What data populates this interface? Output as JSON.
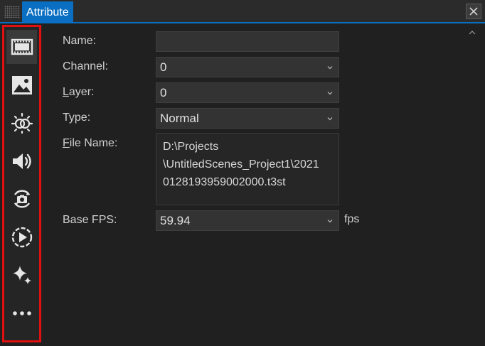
{
  "window": {
    "tab_title": "Attribute",
    "close_icon": "close-icon"
  },
  "sidebar": {
    "items": [
      {
        "icon": "film-icon",
        "selected": true
      },
      {
        "icon": "image-icon",
        "selected": false
      },
      {
        "icon": "brightness-icon",
        "selected": false
      },
      {
        "icon": "speaker-icon",
        "selected": false
      },
      {
        "icon": "camera-rotate-icon",
        "selected": false
      },
      {
        "icon": "play-circle-icon",
        "selected": false
      },
      {
        "icon": "sparkle-icon",
        "selected": false
      },
      {
        "icon": "more-icon",
        "selected": false
      }
    ]
  },
  "form": {
    "name_label": "Name:",
    "name_value": "",
    "channel_label": "Channel:",
    "channel_value": "0",
    "layer_label_first": "L",
    "layer_label_rest": "ayer:",
    "layer_value": "0",
    "type_label": "Type:",
    "type_value": "Normal",
    "filename_label_first": "F",
    "filename_label_rest": "ile Name:",
    "filename_lines": [
      "D:\\Projects",
      "\\UntitledScenes_Project1\\2021",
      "0128193959002000.t3st"
    ],
    "basefps_label": "Base FPS:",
    "basefps_value": "59.94",
    "basefps_unit": "fps"
  },
  "colors": {
    "accent": "#0a6fc2",
    "highlight": "#e01010"
  }
}
